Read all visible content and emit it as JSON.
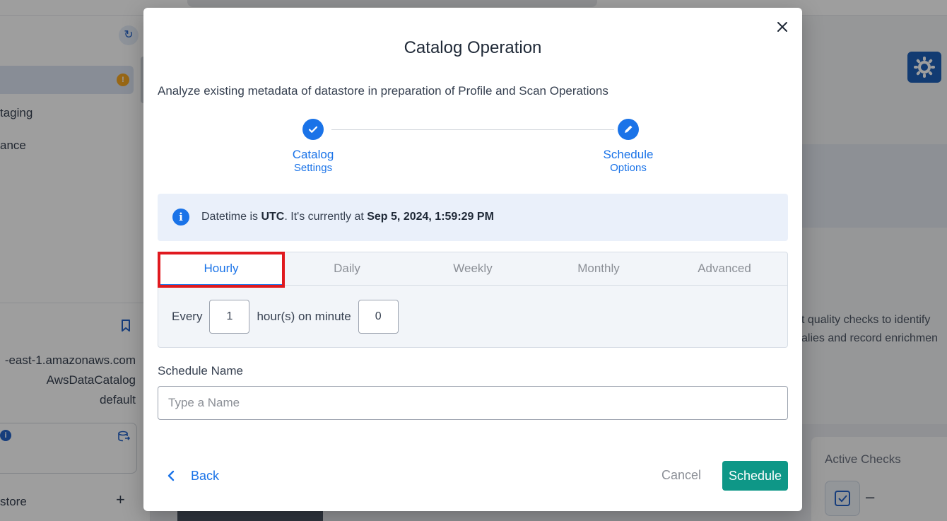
{
  "background": {
    "sidebar": {
      "items": [
        "taging",
        "ance"
      ],
      "meta": [
        "-east-1.amazonaws.com",
        "AwsDataCatalog",
        "default"
      ],
      "section_label": "store"
    },
    "main": {
      "panel_text": [
        "t quality checks to identify",
        "alies and record enrichmen"
      ],
      "active_checks_label": "Active Checks",
      "active_checks_value": "–"
    }
  },
  "modal": {
    "title": "Catalog Operation",
    "description": "Analyze existing metadata of datastore in preparation of Profile and Scan Operations",
    "steps": [
      {
        "line1": "Catalog",
        "line2": "Settings",
        "icon": "check-icon"
      },
      {
        "line1": "Schedule",
        "line2": "Options",
        "icon": "pencil-icon"
      }
    ],
    "info": {
      "prefix": "Datetime is ",
      "timezone": "UTC",
      "middle": ". It's currently at ",
      "datetime": "Sep 5, 2024, 1:59:29 PM"
    },
    "tabs": [
      "Hourly",
      "Daily",
      "Weekly",
      "Monthly",
      "Advanced"
    ],
    "active_tab": "Hourly",
    "frequency": {
      "every_label": "Every",
      "hours_value": "1",
      "minute_label": "hour(s) on minute",
      "minute_value": "0"
    },
    "schedule_name": {
      "label": "Schedule Name",
      "placeholder": "Type a Name",
      "value": ""
    },
    "footer": {
      "back": "Back",
      "cancel": "Cancel",
      "schedule": "Schedule"
    },
    "colors": {
      "primary": "#1a73e8",
      "schedule_button": "#0e9787",
      "highlight": "#e0191f"
    }
  }
}
